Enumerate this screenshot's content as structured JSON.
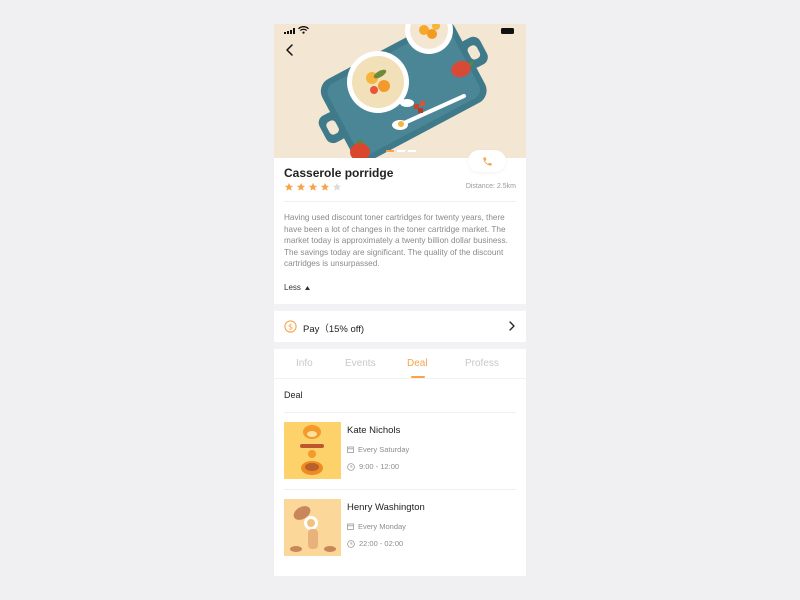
{
  "colors": {
    "accent": "#f7a44b",
    "star_empty": "#dcdcdc",
    "hero_bg": "#f3e6d3",
    "tray": "#3e7a8a"
  },
  "status_bar": {
    "signal_icon": "signal-icon",
    "wifi_icon": "wifi-icon",
    "battery_icon": "battery-icon"
  },
  "hero": {
    "back_icon": "chevron-left-icon",
    "image_alt": "Casserole porridge on a teal tray",
    "carousel_pages": 3,
    "carousel_active": 1
  },
  "detail": {
    "title": "Casserole porridge",
    "rating": 4,
    "rating_max": 5,
    "distance": "Distance: 2.5km",
    "description": "Having used discount toner cartridges for twenty years, there have been a lot of changes in the toner cartridge market. The market today is approximately a twenty billion dollar business. The savings today are significant. The quality of the discount cartridges is unsurpassed.",
    "toggle_label": "Less",
    "call_icon": "phone-icon"
  },
  "pay": {
    "label": "Pay（15% off)",
    "icon": "dollar-coin-icon"
  },
  "tabs": [
    {
      "label": "Info",
      "active": false
    },
    {
      "label": "Events",
      "active": false
    },
    {
      "label": "Deal",
      "active": true
    },
    {
      "label": "Profess",
      "active": false
    }
  ],
  "deal_section": {
    "title": "Deal",
    "items": [
      {
        "name": "Kate Nichols",
        "day": "Every Saturday",
        "time": "9:00 - 12:00"
      },
      {
        "name": "Henry Washington",
        "day": "Every Monday",
        "time": "22:00 - 02:00"
      }
    ]
  }
}
